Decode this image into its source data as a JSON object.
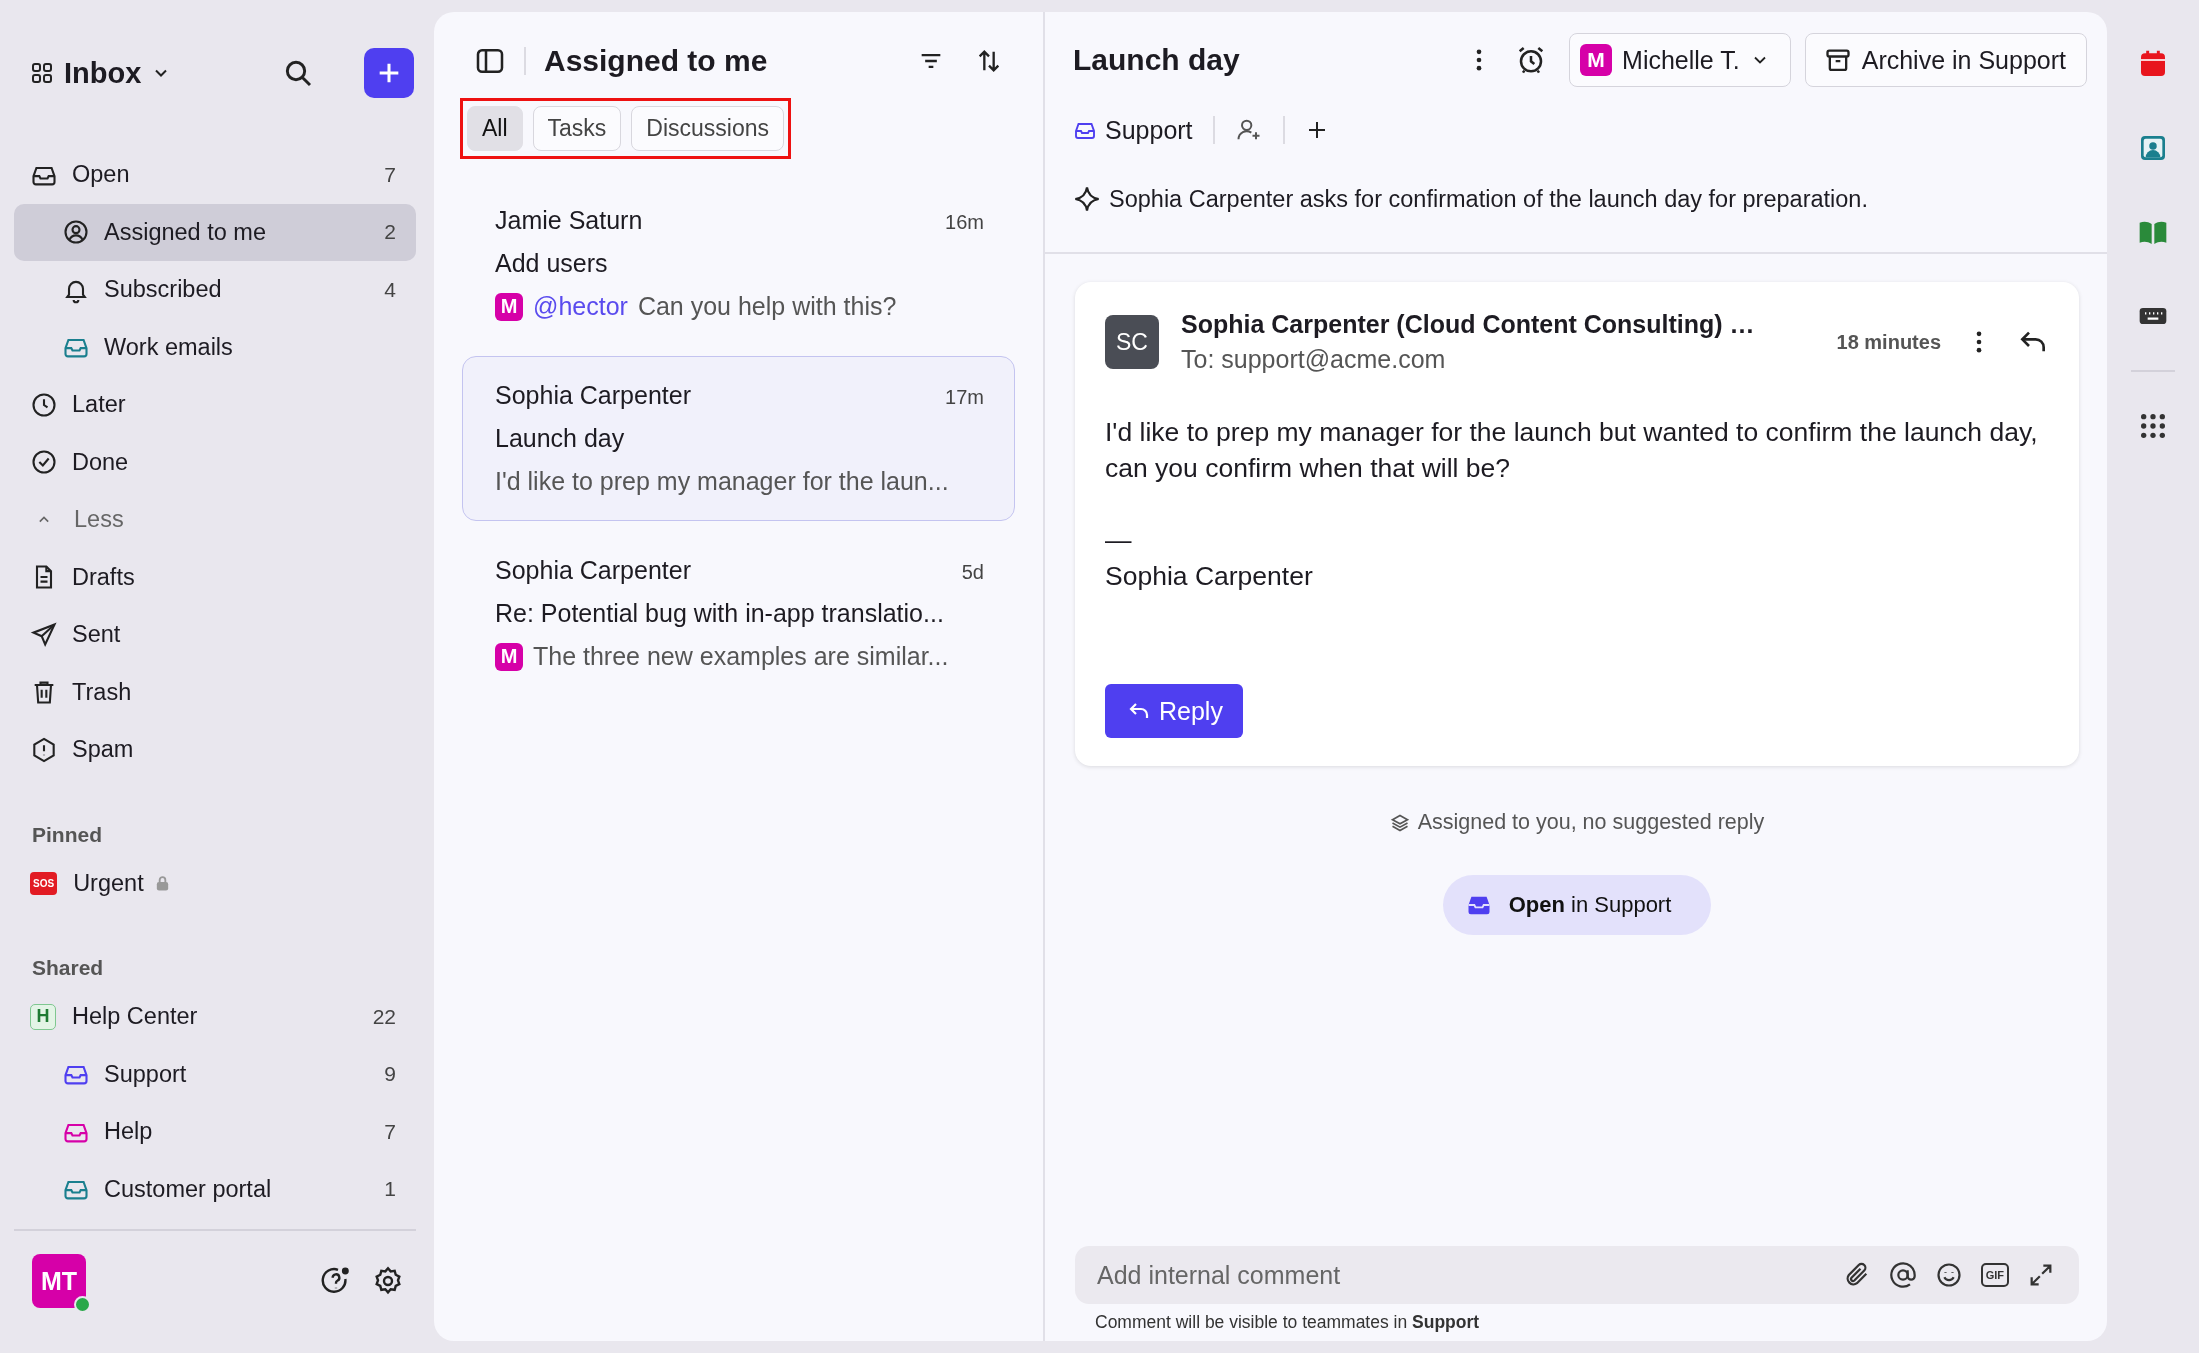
{
  "sidebar": {
    "title": "Inbox",
    "items": [
      {
        "kind": "inbox",
        "label": "Open",
        "count": "7",
        "selected": false,
        "children": [
          {
            "kind": "user",
            "label": "Assigned to me",
            "count": "2",
            "selected": true
          },
          {
            "kind": "bell",
            "label": "Subscribed",
            "count": "4",
            "selected": false
          },
          {
            "kind": "inbox",
            "label": "Work emails",
            "color": "#1a7f8e",
            "selected": false
          }
        ]
      },
      {
        "kind": "clock",
        "label": "Later",
        "selected": false
      },
      {
        "kind": "check",
        "label": "Done",
        "selected": false
      },
      {
        "kind": "toggle",
        "label": "Less",
        "expanded": true
      },
      {
        "kind": "file",
        "label": "Drafts",
        "selected": false
      },
      {
        "kind": "send",
        "label": "Sent",
        "selected": false
      },
      {
        "kind": "trash",
        "label": "Trash",
        "selected": false
      },
      {
        "kind": "alert",
        "label": "Spam",
        "selected": false
      }
    ],
    "pinned": {
      "heading": "Pinned",
      "items": [
        {
          "label": "Urgent",
          "badge": "SOS",
          "locked": true,
          "selected": false
        }
      ]
    },
    "shared": {
      "heading": "Shared",
      "items": [
        {
          "label": "Help Center",
          "badge": "H",
          "count": "22",
          "selected": false,
          "children": [
            {
              "label": "Support",
              "count": "9",
              "color": "#4f3ff0",
              "selected": false
            },
            {
              "label": "Help",
              "count": "7",
              "color": "#d600a8",
              "selected": false
            },
            {
              "label": "Customer portal",
              "count": "1",
              "color": "#1a7f8e",
              "selected": false
            }
          ]
        }
      ]
    },
    "user": {
      "initials": "MT",
      "online": true
    }
  },
  "list": {
    "title": "Assigned to me",
    "filters_highlighted": true,
    "filters": [
      {
        "label": "All",
        "selected": true
      },
      {
        "label": "Tasks",
        "selected": false
      },
      {
        "label": "Discussions",
        "selected": false
      }
    ],
    "conversations": [
      {
        "sender": "Jamie Saturn",
        "time": "16m",
        "subject": "Add users",
        "avatar": "M",
        "mention": "@hector",
        "preview": "Can you help with this?",
        "selected": false
      },
      {
        "sender": "Sophia Carpenter",
        "time": "17m",
        "subject": "Launch day",
        "preview": "I'd like to prep my manager for the laun...",
        "selected": true
      },
      {
        "sender": "Sophia Carpenter",
        "time": "5d",
        "subject": "Re: Potential bug with in-app translatio...",
        "avatar": "M",
        "preview": "The three new examples are similar...",
        "selected": false
      }
    ]
  },
  "thread": {
    "title": "Launch day",
    "assignee": {
      "initial": "M",
      "name": "Michelle T."
    },
    "archive_label": "Archive in Support",
    "inbox_tag": "Support",
    "summary": "Sophia Carpenter asks for confirmation of the launch day for preparation.",
    "message": {
      "avatar": "SC",
      "from": "Sophia Carpenter (Cloud Content Consulting) …",
      "to": "To: support@acme.com",
      "time": "18 minutes",
      "body": [
        "I'd like to prep my manager for the launch but wanted to confirm the launch day, can you confirm when that will be?",
        "—",
        "Sophia Carpenter"
      ],
      "reply_label": "Reply"
    },
    "status": "Assigned to you, no suggested reply",
    "open_button": "**Open** in Support",
    "comment": {
      "placeholder": "Add internal comment",
      "gif_label": "GIF",
      "note": "Comment will be visible to teammates in **Support**"
    }
  }
}
